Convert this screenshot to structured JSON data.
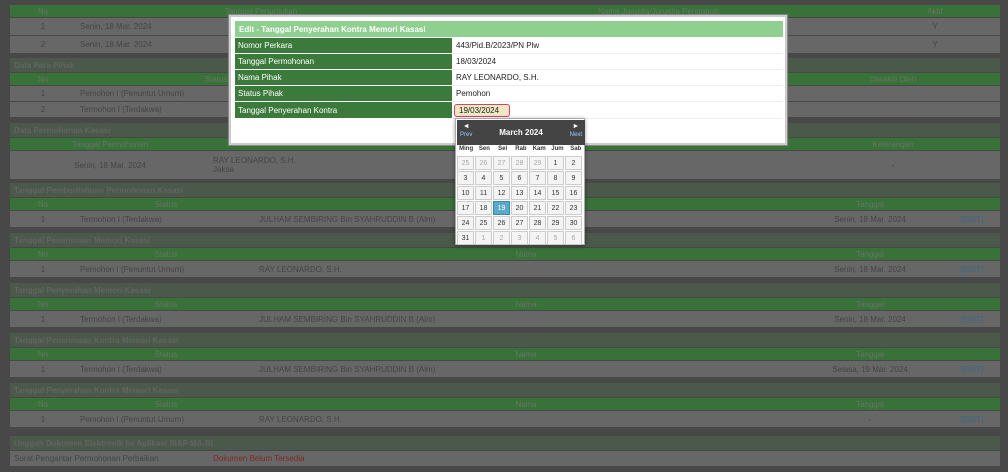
{
  "page": {
    "main_header": [
      "No",
      "Tanggal Penunjukan",
      "Nama Jurusita/Jurusita Pengganti",
      "Aktif"
    ],
    "main_rows": [
      [
        "1",
        "Senin, 18 Mar. 2024",
        "",
        "Y"
      ],
      [
        "2",
        "Senin, 18 Mar. 2024",
        "",
        "Y"
      ]
    ],
    "sec_para_pihak": "Data Para Pihak",
    "para_pihak_header": [
      "No",
      "Status",
      "Diwakili Oleh"
    ],
    "para_pihak_rows": [
      [
        "1",
        "Pemohon I (Penuntut Umum)",
        ""
      ],
      [
        "2",
        "Termohon I (Terdakwa)",
        ""
      ]
    ],
    "sec_permohonan": "Data Permohonan Kasasi",
    "permohonan_header": [
      "Tanggal Permohonan",
      "Keterangan"
    ],
    "permohonan_row": {
      "tanggal": "Senin, 18 Mar. 2024",
      "nama": "RAY LEONARDO, S.H.",
      "sub": "Jaksa",
      "keterangan": "-"
    },
    "sections": [
      {
        "title": "Tanggal Pemberitahuan Permohonan Kasasi",
        "header": [
          "No",
          "Status",
          "",
          "Tanggal"
        ],
        "row": [
          "1",
          "Termohon I (Terdakwa)",
          "JULHAM SEMBIRING Bin SYAHRUDDIN B (Alm)",
          "Senin, 18 Mar. 2024",
          "[EDIT]"
        ]
      },
      {
        "title": "Tanggal Penerimaan Memori Kasasi",
        "header": [
          "No",
          "Status",
          "Nama",
          "Tanggal"
        ],
        "row": [
          "1",
          "Pemohon I (Penuntut Umum)",
          "RAY LEONARDO, S.H.",
          "Senin, 18 Mar. 2024",
          "[EDIT]"
        ]
      },
      {
        "title": "Tanggal Penyerahan Memori Kasasi",
        "header": [
          "No",
          "Status",
          "Nama",
          "Tanggal"
        ],
        "row": [
          "1",
          "Termohon I (Terdakwa)",
          "JULHAM SEMBIRING Bin SYAHRUDDIN B (Alm)",
          "Senin, 18 Mar. 2024",
          "[EDIT]"
        ]
      },
      {
        "title": "Tanggal Penerimaan Kontra Memori Kasasi",
        "header": [
          "No",
          "Status",
          "Nama",
          "Tanggal"
        ],
        "row": [
          "1",
          "Termohon I (Terdakwa)",
          "JULHAM SEMBIRING Bin SYAHRUDDIN B (Alm)",
          "Selasa, 19 Mar. 2024",
          "[EDIT]"
        ]
      },
      {
        "title": "Tanggal Penyerahan Kontra Memori Kasasi",
        "header": [
          "No",
          "Status",
          "Nama",
          "Tanggal"
        ],
        "row": [
          "1",
          "Pemohon I (Penuntut Umum)",
          "RAY LEONARDO, S.H.",
          "-",
          "[EDIT]"
        ]
      }
    ],
    "sec_unggah": "Unggah Dokumen Elektronik ke Aplikasi SIAP MA-RI",
    "unggah_row": {
      "label": "Surat Pengantar Permohonan Perbaikan",
      "value": "Dokumen Belum Tersedia"
    }
  },
  "modal": {
    "title": "Edit - Tanggal Penyerahan Kontra Memori Kasasi",
    "fields": [
      {
        "label": "Nomor Perkara",
        "value": "443/Pid.B/2023/PN Plw"
      },
      {
        "label": "Tanggal Permohonan",
        "value": "18/03/2024"
      },
      {
        "label": "Nama Pihak",
        "value": "RAY LEONARDO, S.H."
      },
      {
        "label": "Status Pihak",
        "value": "Pemohon"
      },
      {
        "label": "Tanggal Penyerahan Kontra",
        "value": "19/03/2024"
      }
    ]
  },
  "calendar": {
    "month": "March 2024",
    "prev_arrow": "◄",
    "prev": "Prev",
    "next_arrow": "►",
    "next": "Next",
    "dows": [
      "Ming",
      "Sen",
      "Sel",
      "Rab",
      "Kam",
      "Jum",
      "Sab"
    ],
    "days": [
      {
        "d": "25",
        "o": true
      },
      {
        "d": "26",
        "o": true
      },
      {
        "d": "27",
        "o": true
      },
      {
        "d": "28",
        "o": true
      },
      {
        "d": "29",
        "o": true
      },
      {
        "d": "1"
      },
      {
        "d": "2"
      },
      {
        "d": "3"
      },
      {
        "d": "4"
      },
      {
        "d": "5"
      },
      {
        "d": "6"
      },
      {
        "d": "7"
      },
      {
        "d": "8"
      },
      {
        "d": "9"
      },
      {
        "d": "10"
      },
      {
        "d": "11"
      },
      {
        "d": "12"
      },
      {
        "d": "13"
      },
      {
        "d": "14"
      },
      {
        "d": "15"
      },
      {
        "d": "16"
      },
      {
        "d": "17"
      },
      {
        "d": "18"
      },
      {
        "d": "19",
        "s": true
      },
      {
        "d": "20"
      },
      {
        "d": "21"
      },
      {
        "d": "22"
      },
      {
        "d": "23"
      },
      {
        "d": "24"
      },
      {
        "d": "25"
      },
      {
        "d": "26"
      },
      {
        "d": "27"
      },
      {
        "d": "28"
      },
      {
        "d": "29"
      },
      {
        "d": "30"
      },
      {
        "d": "31"
      },
      {
        "d": "1",
        "o": true
      },
      {
        "d": "2",
        "o": true
      },
      {
        "d": "3",
        "o": true
      },
      {
        "d": "4",
        "o": true
      },
      {
        "d": "5",
        "o": true
      },
      {
        "d": "6",
        "o": true
      }
    ]
  }
}
